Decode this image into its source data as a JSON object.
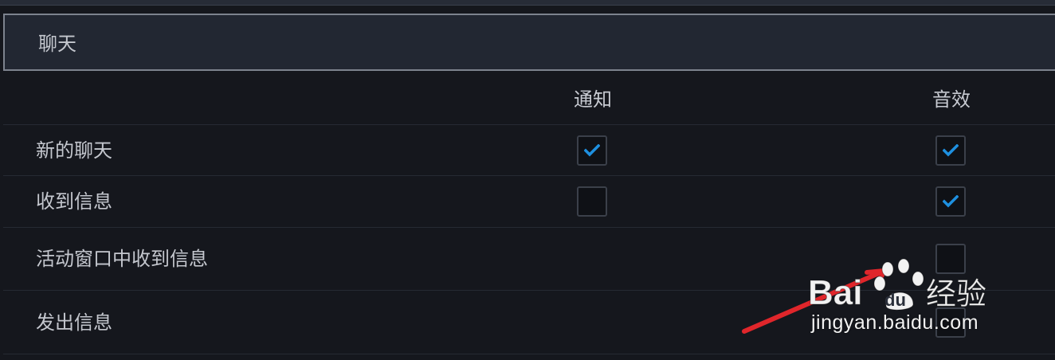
{
  "section": {
    "title": "聊天"
  },
  "columns": {
    "notify": "通知",
    "sound": "音效"
  },
  "rows": [
    {
      "label": "新的聊天",
      "notify": true,
      "sound": true
    },
    {
      "label": "收到信息",
      "notify": false,
      "sound": true
    },
    {
      "label": "活动窗口中收到信息",
      "notify": null,
      "sound": false
    },
    {
      "label": "发出信息",
      "notify": null,
      "sound": false
    }
  ],
  "watermark": {
    "brand": "Bai du 经验",
    "url": "jingyan.baidu.com"
  },
  "colors": {
    "background": "#15171d",
    "header_bg": "#222732",
    "header_border": "#7d838e",
    "check_accent": "#1e90e0",
    "checkbox_bg": "#0f1116",
    "annotation_arrow": "#e0262b"
  },
  "icons": {
    "check": "checkmark-icon",
    "logo": "baidu-paw-icon"
  }
}
